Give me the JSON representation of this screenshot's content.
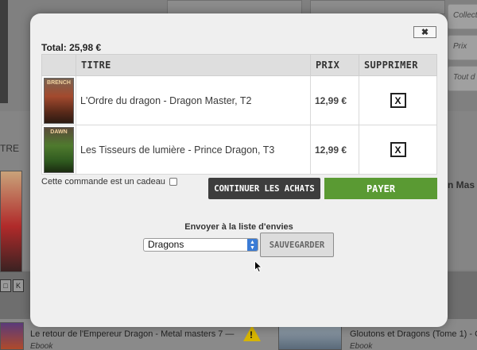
{
  "background": {
    "right_tabs": [
      "Collect",
      "Prix",
      "Tout d"
    ],
    "left_word": "TRE",
    "right_word": "n Mas",
    "bottom_books": [
      {
        "title": "Le retour de l'Empereur Dragon - Metal masters 7 —",
        "format": "Ebook"
      },
      {
        "title": "Gloutons et Dragons (Tome 1) - Gl",
        "format": "Ebook"
      }
    ],
    "small_buttons": [
      "□",
      "K"
    ],
    "warning_icon": "!"
  },
  "modal": {
    "close_label": "✖",
    "total_label": "Total:",
    "total_value": "25,98 €",
    "columns": {
      "title": "TITRE",
      "price": "PRIX",
      "delete": "SUPPRIMER"
    },
    "items": [
      {
        "title": "L'Ordre du dragon - Dragon Master, T2",
        "price": "12,99 €",
        "cover_text": "BRENCH",
        "delete_label": "X"
      },
      {
        "title": "Les Tisseurs de lumière - Prince Dragon, T3",
        "price": "12,99 €",
        "cover_text": "DAWN",
        "delete_label": "X"
      }
    ],
    "gift_label": "Cette commande est un cadeau",
    "continue_label": "CONTINUER LES ACHATS",
    "pay_label": "PAYER",
    "wishlist_label": "Envoyer à la liste d'envies",
    "wishlist_selected": "Dragons",
    "save_label": "SAUVEGARDER"
  },
  "colors": {
    "pay_green": "#5a9a33",
    "continue_dark": "#3d3d3d",
    "select_blue": "#3a7bd5"
  }
}
